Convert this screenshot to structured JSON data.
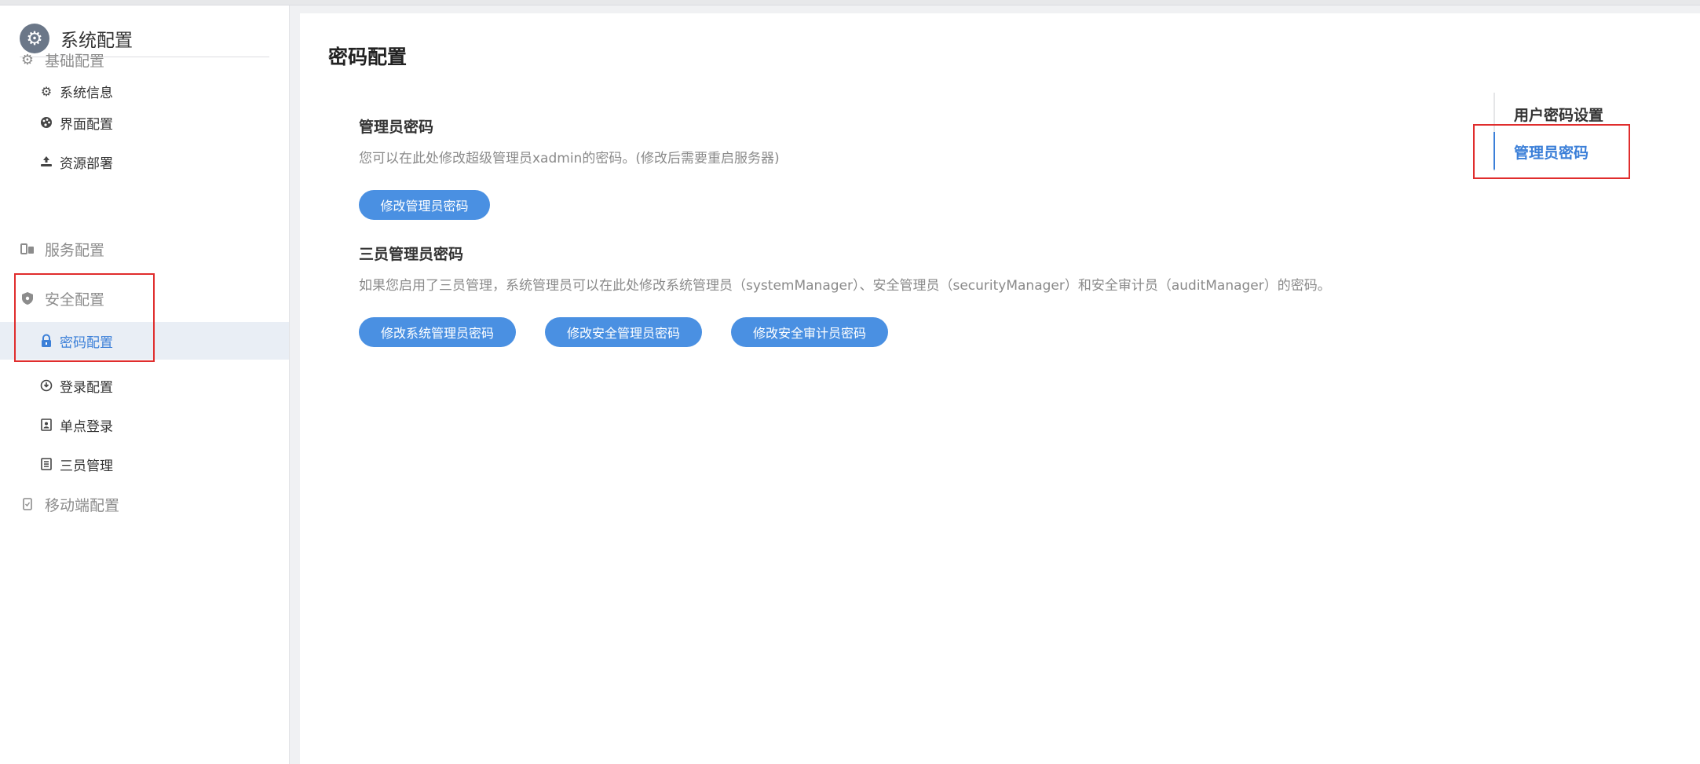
{
  "sidebar": {
    "header": {
      "title": "系统配置",
      "icon": "gear-icon"
    },
    "groups": [
      {
        "label": "基础配置",
        "icon": "gear-icon"
      },
      {
        "label": "服务配置",
        "icon": "server-icon"
      },
      {
        "label": "安全配置",
        "icon": "shield-icon"
      },
      {
        "label": "移动端配置",
        "icon": "mobile-icon"
      }
    ],
    "items": [
      {
        "label": "系统信息",
        "icon": "gear-icon"
      },
      {
        "label": "界面配置",
        "icon": "palette-icon"
      },
      {
        "label": "资源部署",
        "icon": "deploy-icon"
      },
      {
        "label": "密码配置",
        "icon": "lock-icon",
        "active": true
      },
      {
        "label": "登录配置",
        "icon": "login-icon"
      },
      {
        "label": "单点登录",
        "icon": "user-card-icon"
      },
      {
        "label": "三员管理",
        "icon": "list-icon"
      }
    ]
  },
  "main": {
    "title": "密码配置",
    "sections": [
      {
        "title": "管理员密码",
        "description": "您可以在此处修改超级管理员xadmin的密码。(修改后需要重启服务器)",
        "buttons": [
          "修改管理员密码"
        ]
      },
      {
        "title": "三员管理员密码",
        "description": "如果您启用了三员管理，系统管理员可以在此处修改系统管理员（systemManager）、安全管理员（securityManager）和安全审计员（auditManager）的密码。",
        "buttons": [
          "修改系统管理员密码",
          "修改安全管理员密码",
          "修改安全审计员密码"
        ]
      }
    ]
  },
  "anchor": {
    "title": "用户密码设置",
    "links": [
      "管理员密码"
    ]
  },
  "colors": {
    "accent": "#4a90e2",
    "highlight_box": "#e02d2d",
    "active_bg": "#e9eef5"
  }
}
